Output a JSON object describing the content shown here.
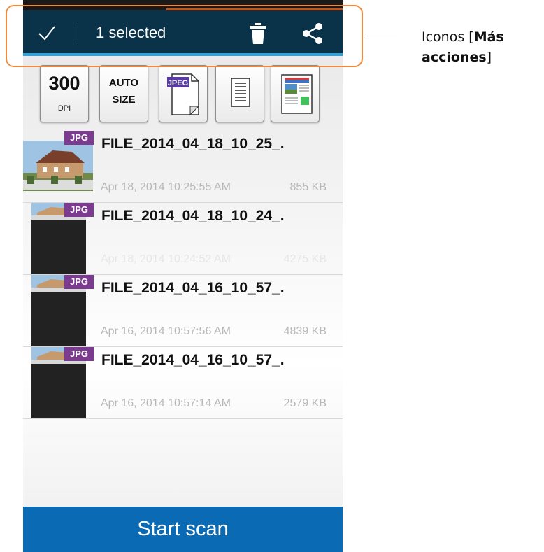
{
  "action_bar": {
    "selected_label": "1 selected",
    "icons": {
      "done": "check-icon",
      "delete": "trash-icon",
      "share": "share-icon"
    },
    "colors": {
      "background": "#0a3349",
      "underline": "#35a0d8"
    }
  },
  "toolbar": {
    "resolution": {
      "value": "300",
      "unit": "DPI"
    },
    "size": {
      "line1": "AUTO",
      "line2": "SIZE"
    },
    "format": {
      "badge": "JPEG",
      "icon": "jpeg-file-icon"
    },
    "document_icon": "document-lines-icon",
    "color_mode_icon": "color-page-icon"
  },
  "files": [
    {
      "type_badge": "JPG",
      "name": "FILE_2014_04_18_10_25_.",
      "date": "Apr 18, 2014 10:25:55 AM",
      "size": "855 KB"
    },
    {
      "type_badge": "JPG",
      "name": "FILE_2014_04_18_10_24_.",
      "date": "Apr 18, 2014 10:24:52 AM",
      "size": "4275 KB"
    },
    {
      "type_badge": "JPG",
      "name": "FILE_2014_04_16_10_57_.",
      "date": "Apr 16, 2014 10:57:56 AM",
      "size": "4839 KB"
    },
    {
      "type_badge": "JPG",
      "name": "FILE_2014_04_16_10_57_.",
      "date": "Apr 16, 2014 10:57:14 AM",
      "size": "2579 KB"
    }
  ],
  "start_scan": {
    "label": "Start scan",
    "color": "#0b6ab4"
  },
  "annotation": {
    "prefix": "Iconos [",
    "bold": "Más acciones",
    "suffix": "]",
    "highlight_color": "#f08a3a"
  }
}
